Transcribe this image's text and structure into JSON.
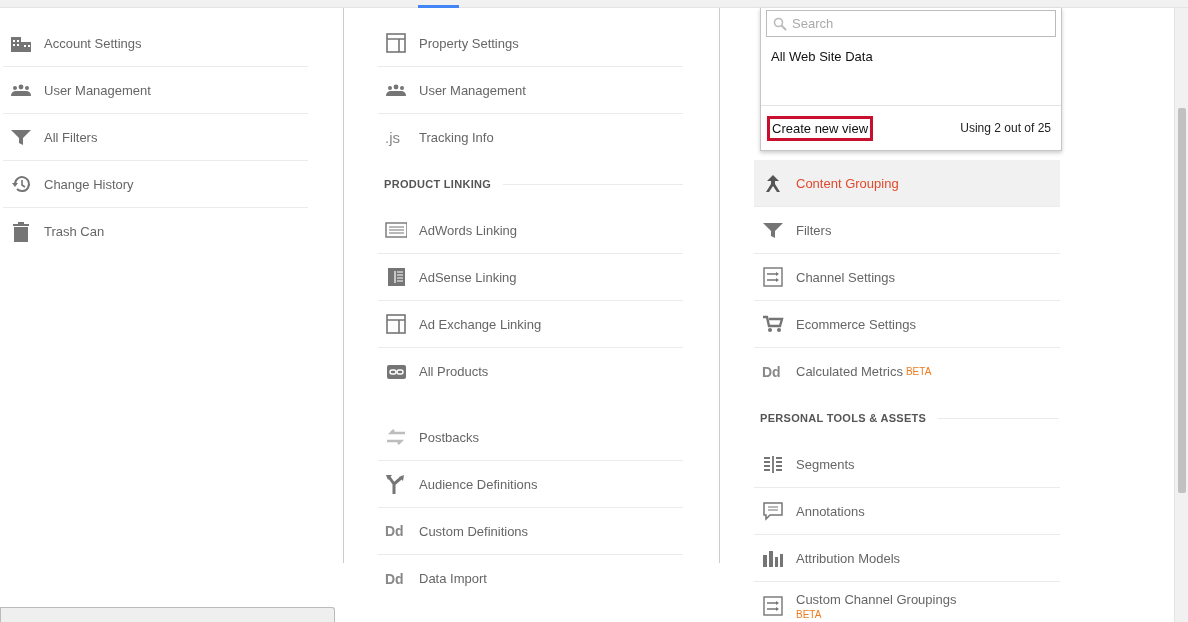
{
  "columns": [
    {
      "sections": [
        {
          "items": [
            {
              "label": "Account Settings",
              "selected": false
            },
            {
              "label": "User Management",
              "selected": false
            },
            {
              "label": "All Filters",
              "selected": false
            },
            {
              "label": "Change History",
              "selected": false
            },
            {
              "label": "Trash Can",
              "selected": false
            }
          ]
        }
      ]
    },
    {
      "sections": [
        {
          "items": [
            {
              "label": "Property Settings",
              "selected": false
            },
            {
              "label": "User Management",
              "selected": false
            },
            {
              "label": "Tracking Info",
              "selected": false,
              "icon_text": ".js"
            }
          ]
        },
        {
          "header": "PRODUCT LINKING",
          "items": [
            {
              "label": "AdWords Linking",
              "selected": false
            },
            {
              "label": "AdSense Linking",
              "selected": false
            },
            {
              "label": "Ad Exchange Linking",
              "selected": false
            },
            {
              "label": "All Products",
              "selected": false
            }
          ]
        },
        {
          "items": [
            {
              "label": "Postbacks",
              "selected": false
            },
            {
              "label": "Audience Definitions",
              "selected": false
            },
            {
              "label": "Custom Definitions",
              "selected": false,
              "icon_text": "Dd"
            },
            {
              "label": "Data Import",
              "selected": false,
              "icon_text": "Dd"
            }
          ]
        }
      ]
    },
    {
      "sections": [
        {
          "items": [
            {
              "label": "Content Grouping",
              "selected": true
            },
            {
              "label": "Filters",
              "selected": false
            },
            {
              "label": "Channel Settings",
              "selected": false
            },
            {
              "label": "Ecommerce Settings",
              "selected": false
            },
            {
              "label": "Calculated Metrics",
              "selected": false,
              "icon_text": "Dd",
              "badge": "BETA",
              "kind": "inline"
            }
          ]
        },
        {
          "header": "PERSONAL TOOLS & ASSETS",
          "items": [
            {
              "label": "Segments",
              "selected": false
            },
            {
              "label": "Annotations",
              "selected": false
            },
            {
              "label": "Attribution Models",
              "selected": false
            },
            {
              "label": "Custom Channel Groupings",
              "selected": false,
              "badge": "BETA",
              "kind": "stacked"
            }
          ]
        }
      ]
    }
  ],
  "view_dropdown": {
    "search": {
      "placeholder": "Search"
    },
    "views": [
      "All Web Site Data"
    ],
    "create_button": {
      "label": "Create new view",
      "highlighted": true
    },
    "usage": "Using 2 out of 25"
  }
}
